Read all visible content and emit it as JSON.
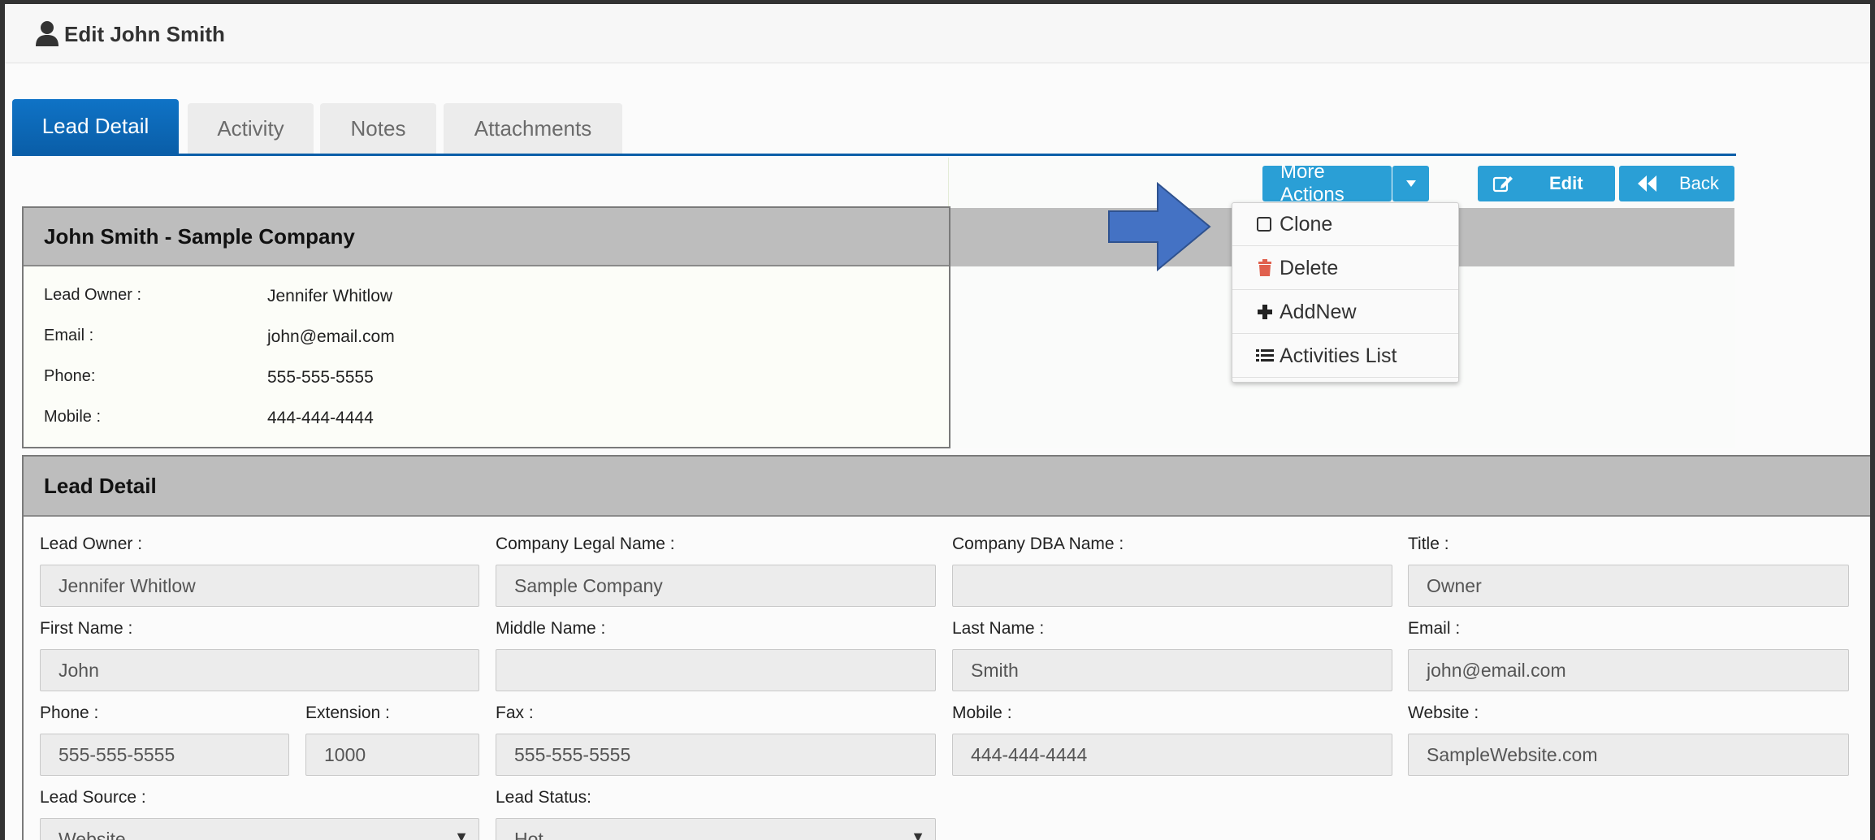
{
  "header": {
    "title": "Edit John Smith",
    "icon": "user-icon"
  },
  "tabs": [
    {
      "label": "Lead Detail",
      "active": true
    },
    {
      "label": "Activity",
      "active": false
    },
    {
      "label": "Notes",
      "active": false
    },
    {
      "label": "Attachments",
      "active": false
    }
  ],
  "actions": {
    "more_actions": "More Actions",
    "edit": "Edit",
    "back": "Back",
    "menu": [
      {
        "label": "Clone",
        "icon": "checkbox-icon"
      },
      {
        "label": "Delete",
        "icon": "trash-icon"
      },
      {
        "label": "AddNew",
        "icon": "plus-icon"
      },
      {
        "label": "Activities List",
        "icon": "list-icon"
      }
    ]
  },
  "summary": {
    "title": "John Smith - Sample Company",
    "rows": [
      {
        "label": "Lead Owner :",
        "value": "Jennifer Whitlow"
      },
      {
        "label": "Email :",
        "value": "john@email.com"
      },
      {
        "label": "Phone:",
        "value": "555-555-5555"
      },
      {
        "label": "Mobile :",
        "value": "444-444-4444"
      }
    ]
  },
  "detail": {
    "title": "Lead Detail",
    "fields": {
      "lead_owner": {
        "label": "Lead Owner :",
        "value": "Jennifer Whitlow"
      },
      "company_legal_name": {
        "label": "Company Legal Name :",
        "value": "Sample Company"
      },
      "company_dba_name": {
        "label": "Company DBA Name :",
        "value": ""
      },
      "title": {
        "label": "Title :",
        "value": "Owner"
      },
      "first_name": {
        "label": "First Name :",
        "value": "John"
      },
      "middle_name": {
        "label": "Middle Name :",
        "value": ""
      },
      "last_name": {
        "label": "Last Name :",
        "value": "Smith"
      },
      "email": {
        "label": "Email :",
        "value": "john@email.com"
      },
      "phone": {
        "label": "Phone :",
        "value": "555-555-5555"
      },
      "extension": {
        "label": "Extension :",
        "value": "1000"
      },
      "fax": {
        "label": "Fax :",
        "value": "555-555-5555"
      },
      "mobile": {
        "label": "Mobile :",
        "value": "444-444-4444"
      },
      "website": {
        "label": "Website :",
        "value": "SampleWebsite.com"
      },
      "lead_source": {
        "label": "Lead Source :",
        "value": "Website"
      },
      "lead_status": {
        "label": "Lead Status:",
        "value": "Hot"
      }
    }
  },
  "colors": {
    "accent": "#2a9fd6",
    "tab_active": "#0b62ad",
    "panel_header": "#bdbdbd",
    "delete_icon": "#e0604e",
    "arrow": "#4472c4"
  }
}
